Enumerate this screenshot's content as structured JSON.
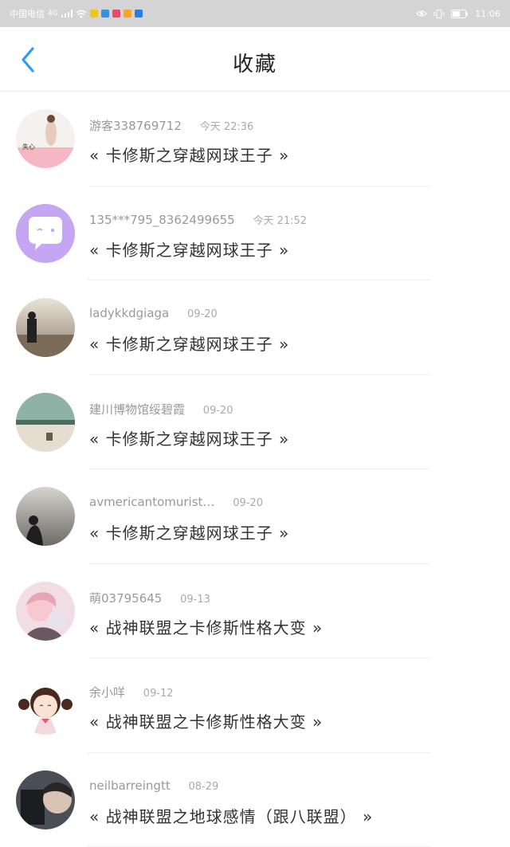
{
  "status_bar": {
    "carrier": "中国电信",
    "network": "4G",
    "time": "11:06"
  },
  "header": {
    "title": "收藏",
    "back_icon": "chevron-left-icon",
    "accent_color": "#2a9df4"
  },
  "favorites": [
    {
      "user": "游客338769712",
      "time": "今天 22:36",
      "title": "« 卡修斯之穿越网球王子 »"
    },
    {
      "user": "135***795_8362499655",
      "time": "今天 21:52",
      "title": "« 卡修斯之穿越网球王子 »"
    },
    {
      "user": "ladykkdgiaga",
      "time": "09-20",
      "title": "« 卡修斯之穿越网球王子 »"
    },
    {
      "user": "建川博物馆绥碧霞",
      "time": "09-20",
      "title": "« 卡修斯之穿越网球王子 »"
    },
    {
      "user": "avmericantomurist…",
      "time": "09-20",
      "title": "« 卡修斯之穿越网球王子 »"
    },
    {
      "user": "萌03795645",
      "time": "09-13",
      "title": "« 战神联盟之卡修斯性格大变 »"
    },
    {
      "user": "余小咩",
      "time": "09-12",
      "title": "« 战神联盟之卡修斯性格大变 »"
    },
    {
      "user": "neilbarreingtt",
      "time": "08-29",
      "title": "« 战神联盟之地球感情（跟八联盟） »"
    }
  ]
}
